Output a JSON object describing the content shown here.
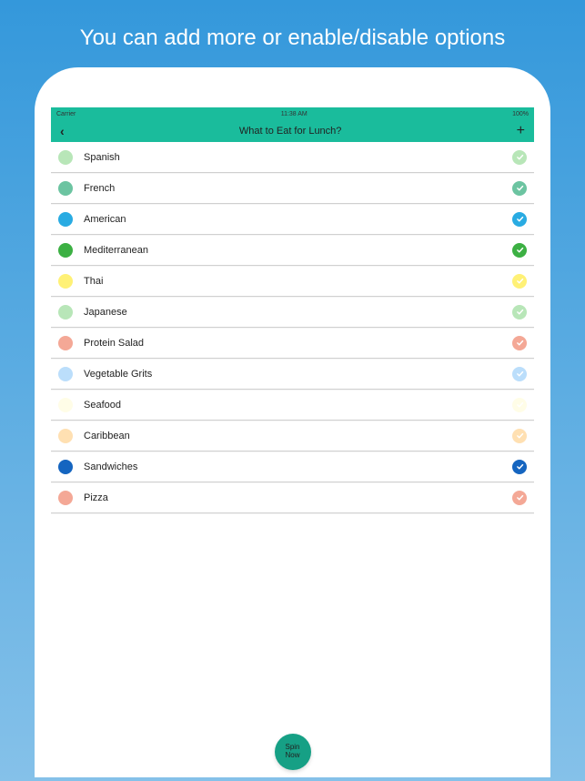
{
  "promo": {
    "headline": "You can add more or enable/disable options"
  },
  "statusBar": {
    "carrier": "Carrier",
    "time": "11:38 AM",
    "battery": "100%"
  },
  "nav": {
    "back": "‹",
    "title": "What to Eat for Lunch?",
    "add": "+"
  },
  "items": [
    {
      "label": "Spanish",
      "dotColor": "#b8e6b8",
      "checkColor": "#b8e6b8"
    },
    {
      "label": "French",
      "dotColor": "#6cc4a1",
      "checkColor": "#6cc4a1"
    },
    {
      "label": "American",
      "dotColor": "#29abe2",
      "checkColor": "#29abe2"
    },
    {
      "label": "Mediterranean",
      "dotColor": "#3cb043",
      "checkColor": "#3cb043"
    },
    {
      "label": "Thai",
      "dotColor": "#fff176",
      "checkColor": "#fff176"
    },
    {
      "label": "Japanese",
      "dotColor": "#b8e6b8",
      "checkColor": "#b8e6b8"
    },
    {
      "label": "Protein Salad",
      "dotColor": "#f4a896",
      "checkColor": "#f4a896"
    },
    {
      "label": "Vegetable Grits",
      "dotColor": "#bbdefb",
      "checkColor": "#bbdefb"
    },
    {
      "label": "Seafood",
      "dotColor": "#fffde7",
      "checkColor": "#fffde7"
    },
    {
      "label": "Caribbean",
      "dotColor": "#ffe0b2",
      "checkColor": "#ffe0b2"
    },
    {
      "label": "Sandwiches",
      "dotColor": "#1565c0",
      "checkColor": "#1565c0"
    },
    {
      "label": "Pizza",
      "dotColor": "#f4a896",
      "checkColor": "#f4a896"
    }
  ],
  "spin": {
    "label": "Spin\nNow"
  }
}
